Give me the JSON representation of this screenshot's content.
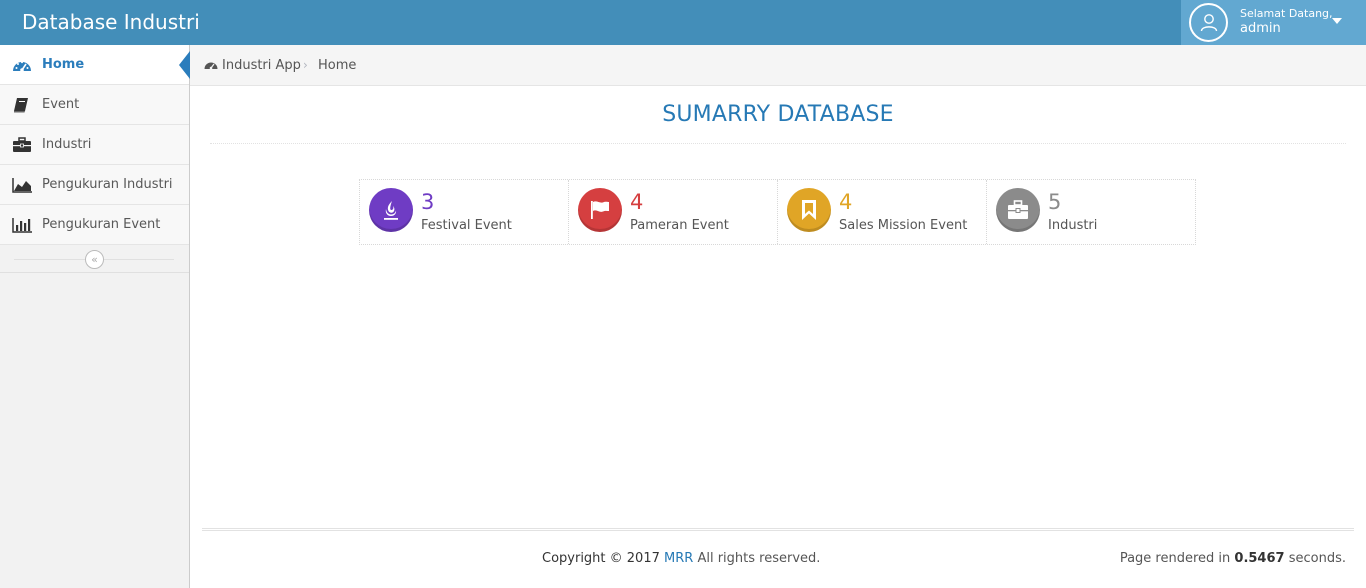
{
  "header": {
    "brand": "Database Industri",
    "welcome": "Selamat Datang,",
    "username": "admin"
  },
  "sidebar": {
    "items": [
      {
        "label": "Home",
        "icon": "dashboard-icon"
      },
      {
        "label": "Event",
        "icon": "book-icon"
      },
      {
        "label": "Industri",
        "icon": "briefcase-icon"
      },
      {
        "label": "Pengukuran Industri",
        "icon": "area-chart-icon"
      },
      {
        "label": "Pengukuran Event",
        "icon": "bar-chart-icon"
      }
    ],
    "collapse_glyph": "«"
  },
  "breadcrumb": {
    "app": "Industri App",
    "separator": "›",
    "current": "Home"
  },
  "main": {
    "title": "SUMARRY DATABASE",
    "infoboxes": [
      {
        "value": "3",
        "label": "Festival Event",
        "color": "#6f3cc4",
        "icon": "fire-icon"
      },
      {
        "value": "4",
        "label": "Pameran Event",
        "color": "#d53f40",
        "icon": "flag-icon"
      },
      {
        "value": "4",
        "label": "Sales Mission Event",
        "color": "#e0a526",
        "icon": "bookmark-icon"
      },
      {
        "value": "5",
        "label": "Industri",
        "color": "#8b8b8b",
        "icon": "briefcase-icon"
      }
    ]
  },
  "footer": {
    "copyright_prefix": "Copyright © 2017",
    "copyright_brand": "MRR",
    "copyright_suffix": "All rights reserved.",
    "rendered_prefix": "Page rendered in",
    "rendered_time": "0.5467",
    "rendered_suffix": "seconds."
  },
  "colors": {
    "navbar": "#438eb9",
    "user_box": "#62a8d1",
    "accent": "#2679b5"
  }
}
